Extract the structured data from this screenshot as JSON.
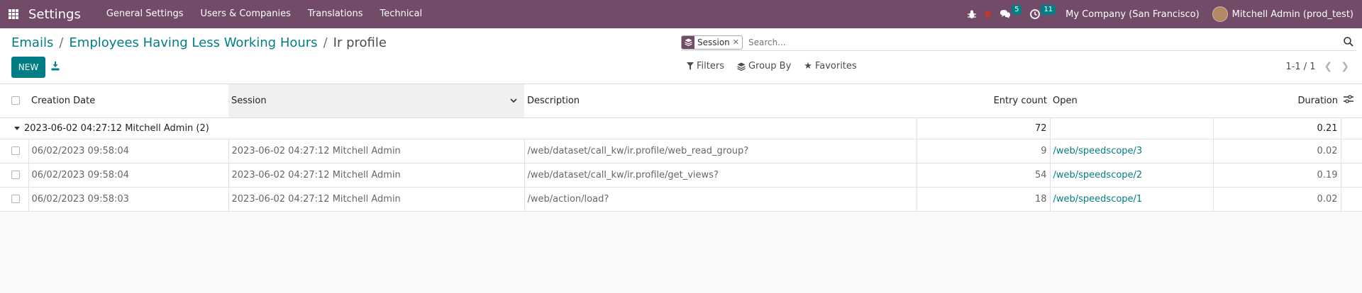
{
  "navbar": {
    "app_name": "Settings",
    "menu": [
      "General Settings",
      "Users & Companies",
      "Translations",
      "Technical"
    ],
    "messages_count": "5",
    "activities_count": "11",
    "company": "My Company (San Francisco)",
    "user": "Mitchell Admin (prod_test)",
    "bg_color": "#714b67"
  },
  "breadcrumb": {
    "item1": "Emails",
    "item2": "Employees Having Less Working Hours",
    "current": "Ir profile"
  },
  "toolbar": {
    "new_label": "NEW"
  },
  "search": {
    "facet_value": "Session",
    "placeholder": "Search..."
  },
  "filters": {
    "filters_label": "Filters",
    "groupby_label": "Group By",
    "favorites_label": "Favorites"
  },
  "pager": {
    "value": "1-1 / 1"
  },
  "table": {
    "columns": [
      "Creation Date",
      "Session",
      "Description",
      "Entry count",
      "Open",
      "Duration"
    ],
    "group": {
      "label": "2023-06-02 04:27:12 Mitchell Admin (2)",
      "entry_count": "72",
      "duration": "0.21"
    },
    "rows": [
      {
        "date": "06/02/2023 09:58:04",
        "session": "2023-06-02 04:27:12 Mitchell Admin",
        "description": "/web/dataset/call_kw/ir.profile/web_read_group?",
        "entry_count": "9",
        "open": "/web/speedscope/3",
        "duration": "0.02"
      },
      {
        "date": "06/02/2023 09:58:04",
        "session": "2023-06-02 04:27:12 Mitchell Admin",
        "description": "/web/dataset/call_kw/ir.profile/get_views?",
        "entry_count": "54",
        "open": "/web/speedscope/2",
        "duration": "0.19"
      },
      {
        "date": "06/02/2023 09:58:03",
        "session": "2023-06-02 04:27:12 Mitchell Admin",
        "description": "/web/action/load?",
        "entry_count": "18",
        "open": "/web/speedscope/1",
        "duration": "0.02"
      }
    ]
  },
  "accent_color": "#017e84"
}
